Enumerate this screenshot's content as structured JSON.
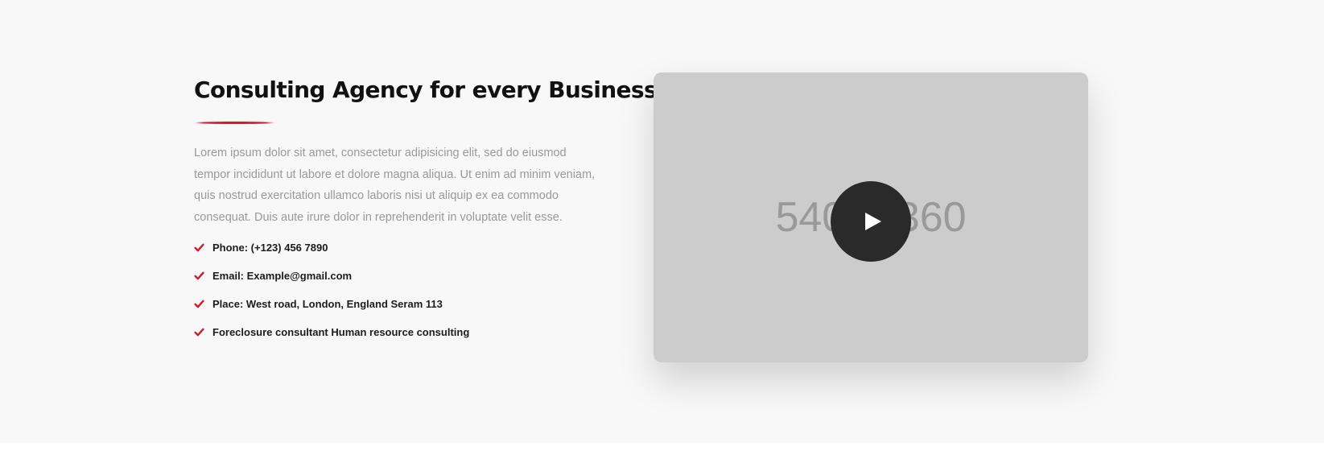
{
  "section": {
    "title": "Consulting Agency for every Business",
    "intro": "Lorem ipsum dolor sit amet, consectetur adipisicing elit, sed do eiusmod tempor incididunt ut labore et dolore magna aliqua. Ut enim ad minim veniam, quis nostrud exercitation ullamco laboris nisi ut aliquip ex ea commodo consequat. Duis aute irure dolor in reprehenderit in voluptate velit esse.",
    "facts": [
      {
        "icon": "check-icon",
        "text": "Phone: (+123) 456 7890"
      },
      {
        "icon": "check-icon",
        "text": "Email: Example@gmail.com"
      },
      {
        "icon": "check-icon",
        "text": "Place: West road, London, England Seram 113"
      },
      {
        "icon": "check-icon",
        "text": "Foreclosure consultant Human resource consulting"
      }
    ]
  },
  "video": {
    "placeholder_text": "540 X 360",
    "play_icon": "play-icon"
  },
  "colors": {
    "accent": "#cf1e2b",
    "section_background": "#f8f8f8",
    "placeholder_background": "#cccccc",
    "play_button_background": "#2a2a2a"
  }
}
